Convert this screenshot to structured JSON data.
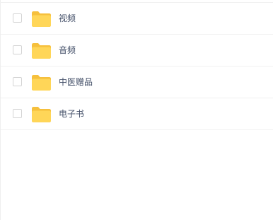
{
  "files": [
    {
      "name": "视频",
      "icon": "folder-icon"
    },
    {
      "name": "音频",
      "icon": "folder-icon"
    },
    {
      "name": "中医赠品",
      "icon": "folder-icon"
    },
    {
      "name": "电子书",
      "icon": "folder-icon"
    }
  ],
  "colors": {
    "folder_body": "#FFD658",
    "folder_tab": "#F6C03D",
    "text": "#424E67",
    "divider": "#F1F1F1",
    "checkbox_border": "#D4D4D4"
  }
}
